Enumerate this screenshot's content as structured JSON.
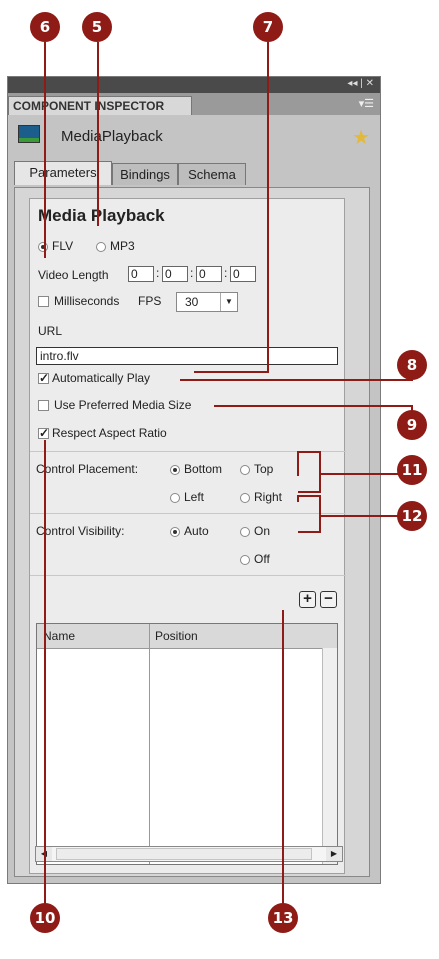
{
  "callouts": [
    "6",
    "5",
    "7",
    "8",
    "9",
    "11",
    "12",
    "10",
    "13"
  ],
  "panel": {
    "title": "COMPONENT INSPECTOR",
    "component_name": "MediaPlayback",
    "tabs": [
      "Parameters",
      "Bindings",
      "Schema"
    ],
    "active_tab": "Parameters"
  },
  "content": {
    "heading": "Media Playback",
    "format_flv": "FLV",
    "format_mp3": "MP3",
    "selected_format": "FLV",
    "video_length_label": "Video Length",
    "video_length_values": [
      "0",
      "0",
      "0",
      "0"
    ],
    "milliseconds_label": "Milliseconds",
    "milliseconds_checked": false,
    "fps_label": "FPS",
    "fps_value": "30",
    "url_label": "URL",
    "url_value": "intro.flv",
    "auto_play_label": "Automatically Play",
    "auto_play_checked": true,
    "preferred_size_label": "Use Preferred Media Size",
    "preferred_size_checked": false,
    "aspect_ratio_label": "Respect Aspect Ratio",
    "aspect_ratio_checked": true,
    "control_placement_label": "Control Placement:",
    "placement_options": [
      "Bottom",
      "Top",
      "Left",
      "Right"
    ],
    "placement_selected": "Bottom",
    "control_visibility_label": "Control Visibility:",
    "visibility_options": [
      "Auto",
      "On",
      "Off"
    ],
    "visibility_selected": "Auto",
    "add_symbol": "+",
    "remove_symbol": "−",
    "cue_columns": [
      "Name",
      "Position"
    ],
    "check_mark": "✓"
  },
  "colors": {
    "callout": "#8e1b16",
    "panel_bg": "#c4c4c4",
    "content_bg": "#ececec"
  }
}
